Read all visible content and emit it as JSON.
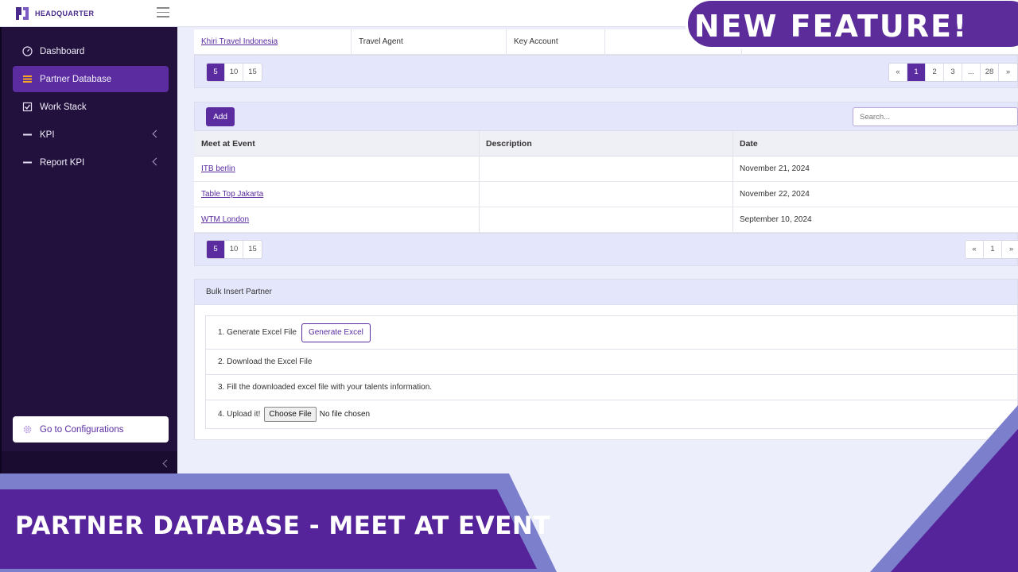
{
  "app": {
    "logo_text": "HEADQUARTER"
  },
  "sidebar": {
    "items": [
      {
        "label": "Dashboard",
        "icon": "gauge-icon",
        "active": false
      },
      {
        "label": "Partner Database",
        "icon": "list-icon",
        "active": true
      },
      {
        "label": "Work Stack",
        "icon": "checkbox-icon",
        "active": false
      },
      {
        "label": "KPI",
        "icon": "dash-icon",
        "active": false,
        "has_submenu": true
      },
      {
        "label": "Report KPI",
        "icon": "dash-icon",
        "active": false,
        "has_submenu": true
      }
    ],
    "config_label": "Go to Configurations"
  },
  "partner_table": {
    "row": {
      "name": "Khiri Travel Indonesia",
      "type": "Travel Agent",
      "category": "Key Account"
    },
    "page_sizes": [
      "5",
      "10",
      "15"
    ],
    "page_size_selected": "5",
    "pages": [
      "«",
      "1",
      "2",
      "3",
      "...",
      "28",
      "»"
    ],
    "current_page": "1"
  },
  "event_table": {
    "add_label": "Add",
    "search_placeholder": "Search...",
    "columns": [
      "Meet at Event",
      "Description",
      "Date"
    ],
    "rows": [
      {
        "event": "ITB berlin",
        "description": "",
        "date": "November 21, 2024"
      },
      {
        "event": "Table Top Jakarta",
        "description": "",
        "date": "November 22, 2024"
      },
      {
        "event": "WTM London",
        "description": "",
        "date": "September 10, 2024"
      }
    ],
    "page_sizes": [
      "5",
      "10",
      "15"
    ],
    "page_size_selected": "5",
    "pages": [
      "«",
      "1",
      "»"
    ]
  },
  "bulk_insert": {
    "title": "Bulk Insert Partner",
    "step1": "1. Generate Excel File",
    "generate_label": "Generate Excel",
    "step2": "2. Download the Excel File",
    "step3": "3. Fill the downloaded excel file with your talents information.",
    "step4": "4. Upload it!",
    "choose_file_label": "Choose File",
    "no_file_text": "No file chosen"
  },
  "promo": {
    "badge": "NEW FEATURE!",
    "title": "PARTNER DATABASE - MEET AT EVENT"
  },
  "colors": {
    "primary": "#5a2ca0",
    "sidebar": "#22103d",
    "promo_dark": "#55249a",
    "promo_light": "#7b7fcc"
  }
}
